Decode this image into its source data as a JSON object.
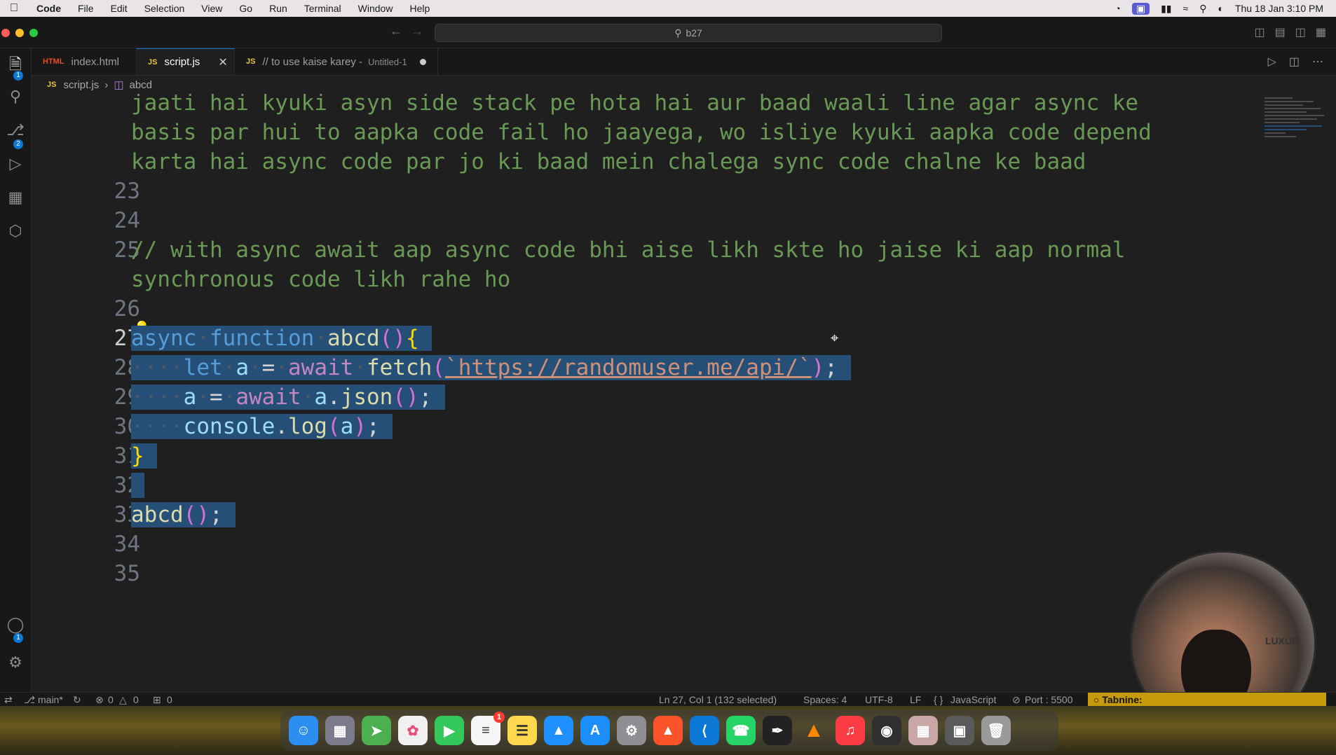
{
  "menubar": {
    "app": "Code",
    "items": [
      "File",
      "Edit",
      "Selection",
      "View",
      "Go",
      "Run",
      "Terminal",
      "Window",
      "Help"
    ],
    "clock": "Thu 18 Jan  3:10 PM"
  },
  "titlebar": {
    "search_text": "b27"
  },
  "tabs": [
    {
      "label": "index.html",
      "icon": "HTML"
    },
    {
      "label": "script.js",
      "icon": "JS"
    },
    {
      "label": "// to use kaise karey -",
      "sub": "Untitled-1",
      "icon": "JS"
    }
  ],
  "breadcrumb": {
    "file": "script.js",
    "symbol": "abcd"
  },
  "editor": {
    "wrap1": "jaati hai kyuki asyn side stack pe hota hai aur baad waali line agar async ke",
    "wrap2": "basis par hui to aapka code fail ho jaayega, wo isliye kyuki aapka code depend",
    "wrap3": "karta hai async code par jo ki baad mein chalega sync code chalne ke baad",
    "comment25a": "// with async await aap async code bhi aise likh skte ho jaise ki aap normal",
    "comment25b": "synchronous code likh rahe ho",
    "line_numbers": [
      "23",
      "24",
      "25",
      "26",
      "27",
      "28",
      "29",
      "30",
      "31",
      "32",
      "33",
      "34",
      "35"
    ],
    "url": "https://randomuser.me/api/"
  },
  "activity_badges": {
    "explorer": "1",
    "scm": "2",
    "accounts": "1"
  },
  "statusbar": {
    "branch": "main*",
    "errors": "0",
    "warnings": "0",
    "ports_count": "0",
    "position": "Ln 27, Col 1 (132 selected)",
    "spaces": "Spaces: 4",
    "encoding": "UTF-8",
    "eol": "LF",
    "language": "JavaScript",
    "port": "Port : 5500",
    "tabnine": "Tabnine:"
  },
  "webcam": {
    "brand": "LUXUR"
  },
  "dock": {
    "reminders_badge": "1",
    "apps": [
      "finder-icon",
      "launchpad-icon",
      "maps-icon",
      "photos-icon",
      "facetime-icon",
      "reminders-icon",
      "notes-icon",
      "keynote-icon",
      "appstore-icon",
      "settings-icon",
      "brave-icon",
      "vscode-icon",
      "whatsapp-icon",
      "pen-icon",
      "vlc-icon",
      "music-icon",
      "obs-icon",
      "preview-icon",
      "screenshot-icon",
      "trash-icon"
    ]
  },
  "colors": {
    "accent": "#0a78d4",
    "selection": "#264f78",
    "tabnine": "#c59a0b"
  }
}
